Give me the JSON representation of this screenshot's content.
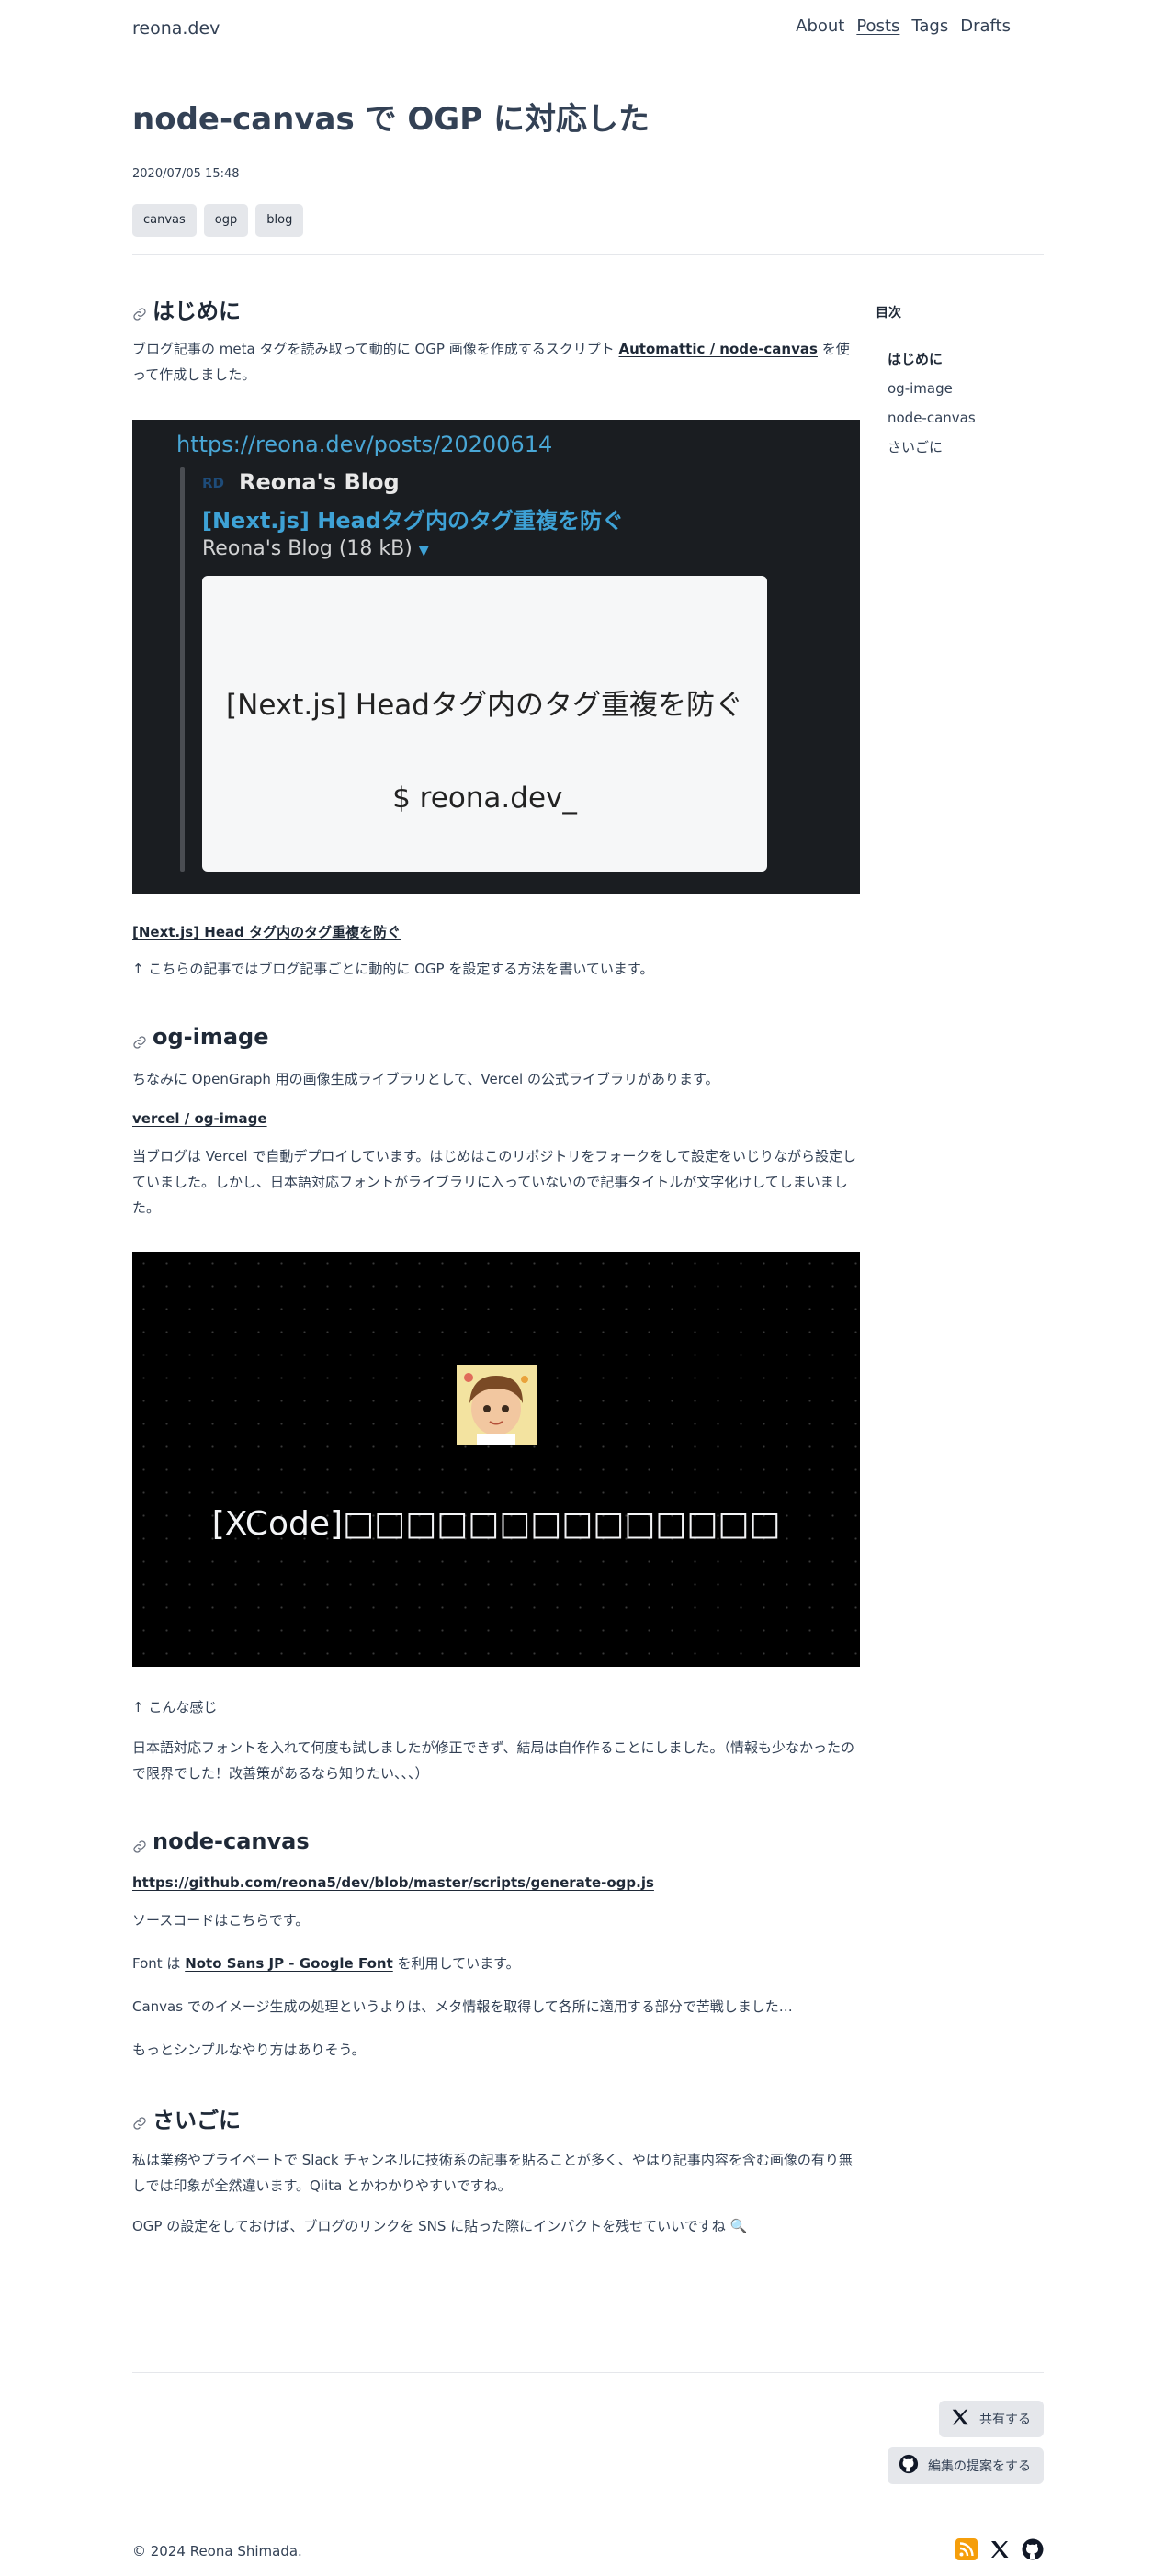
{
  "header": {
    "site_name": "reona.dev",
    "nav": [
      "About",
      "Posts",
      "Tags",
      "Drafts"
    ],
    "active_nav": "Posts"
  },
  "post": {
    "title": "node-canvas で OGP に対応した",
    "date": "2020/07/05 15:48",
    "tags": [
      "canvas",
      "ogp",
      "blog"
    ]
  },
  "toc": {
    "title": "目次",
    "items": [
      "はじめに",
      "og-image",
      "node-canvas",
      "さいごに"
    ]
  },
  "sections": {
    "intro": {
      "heading": "はじめに",
      "p1_before": "ブログ記事の meta タグを読み取って動的に OGP 画像を作成するスクリプト ",
      "p1_link": "Automattic / node-canvas",
      "p1_after": " を使って作成しました。",
      "slack": {
        "url": "https://reona.dev/posts/20200614",
        "logo": "RD",
        "site": "Reona's Blog",
        "title": "[Next.js] Headタグ内のタグ重複を防ぐ",
        "meta": "Reona's Blog (18 kB)",
        "card_title": "[Next.js] Headタグ内のタグ重複を防ぐ",
        "card_sub": "$ reona.dev_"
      },
      "link": "[Next.js] Head タグ内のタグ重複を防ぐ",
      "p2": "↑ こちらの記事ではブログ記事ごとに動的に OGP を設定する方法を書いています。"
    },
    "og_image": {
      "heading": "og-image",
      "p1": "ちなみに OpenGraph 用の画像生成ライブラリとして、Vercel の公式ライブラリがあります。",
      "link": "vercel / og-image",
      "p2": "当ブログは Vercel で自動デプロイしています。はじめはこのリポジトリをフォークをして設定をいじりながら設定していました。しかし、日本語対応フォントがライブラリに入っていないので記事タイトルが文字化けしてしまいました。",
      "image_text": "[XCode]□□□□□□□□□□□□□□",
      "p3": "↑ こんな感じ",
      "p4": "日本語対応フォントを入れて何度も試しましたが修正できず、結局は自作作ることにしました。（情報も少なかったので限界でした！改善策があるなら知りたい、、、）"
    },
    "node_canvas": {
      "heading": "node-canvas",
      "link": "https://github.com/reona5/dev/blob/master/scripts/generate-ogp.js",
      "p1": "ソースコードはこちらです。",
      "p2_before": "Font は ",
      "p2_link": "Noto Sans JP - Google Font",
      "p2_after": " を利用しています。",
      "p3": "Canvas でのイメージ生成の処理というよりは、メタ情報を取得して各所に適用する部分で苦戦しました…",
      "p4": "もっとシンプルなやり方はありそう。"
    },
    "outro": {
      "heading": "さいごに",
      "p1": "私は業務やプライベートで Slack チャンネルに技術系の記事を貼ることが多く、やはり記事内容を含む画像の有り無しでは印象が全然違います。Qiita とかわかりやすいですね。",
      "p2": "OGP の設定をしておけば、ブログのリンクを SNS に貼った際にインパクトを残せていいですね 🔍"
    }
  },
  "actions": {
    "share": "共有する",
    "suggest_edit": "編集の提案をする"
  },
  "footer": {
    "copyright": "© 2024 Reona Shimada."
  },
  "colors": {
    "text": "#334155",
    "tag_bg": "#e5e7eb",
    "slack_link": "#3ea2d6",
    "rss": "#f59e0b"
  }
}
